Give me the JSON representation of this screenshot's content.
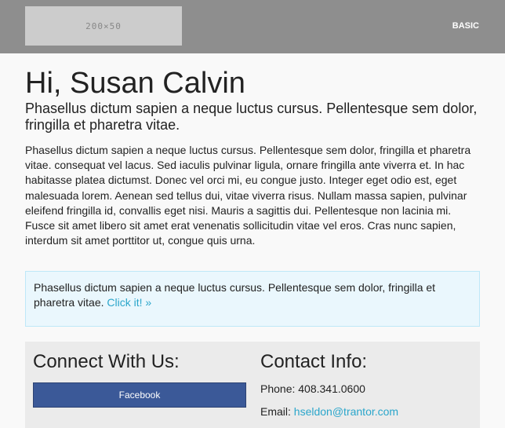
{
  "header": {
    "logo_text": "200×50",
    "nav_label": "BASIC"
  },
  "main": {
    "greeting": "Hi, Susan Calvin",
    "subheading": "Phasellus dictum sapien a neque luctus cursus. Pellentesque sem dolor, fringilla et pharetra vitae.",
    "body": "Phasellus dictum sapien a neque luctus cursus. Pellentesque sem dolor, fringilla et pharetra vitae. consequat vel lacus. Sed iaculis pulvinar ligula, ornare fringilla ante viverra et. In hac habitasse platea dictumst. Donec vel orci mi, eu congue justo. Integer eget odio est, eget malesuada lorem. Aenean sed tellus dui, vitae viverra risus. Nullam massa sapien, pulvinar eleifend fringilla id, convallis eget nisi. Mauris a sagittis dui. Pellentesque non lacinia mi. Fusce sit amet libero sit amet erat venenatis sollicitudin vitae vel eros. Cras nunc sapien, interdum sit amet porttitor ut, congue quis urna."
  },
  "callout": {
    "text": "Phasellus dictum sapien a neque luctus cursus. Pellentesque sem dolor, fringilla et pharetra vitae.",
    "link_label": "Click it! »"
  },
  "footer": {
    "connect_heading": "Connect With Us:",
    "facebook_label": "Facebook",
    "contact_heading": "Contact Info:",
    "phone_label": "Phone:",
    "phone_value": "408.341.0600",
    "email_label": "Email:",
    "email_value": "hseldon@trantor.com"
  },
  "colors": {
    "header_bg": "#8e8e8e",
    "link": "#2ba6cb",
    "callout_bg": "#eaf7fd",
    "facebook": "#3b5998",
    "footer_bg": "#ebebeb"
  }
}
